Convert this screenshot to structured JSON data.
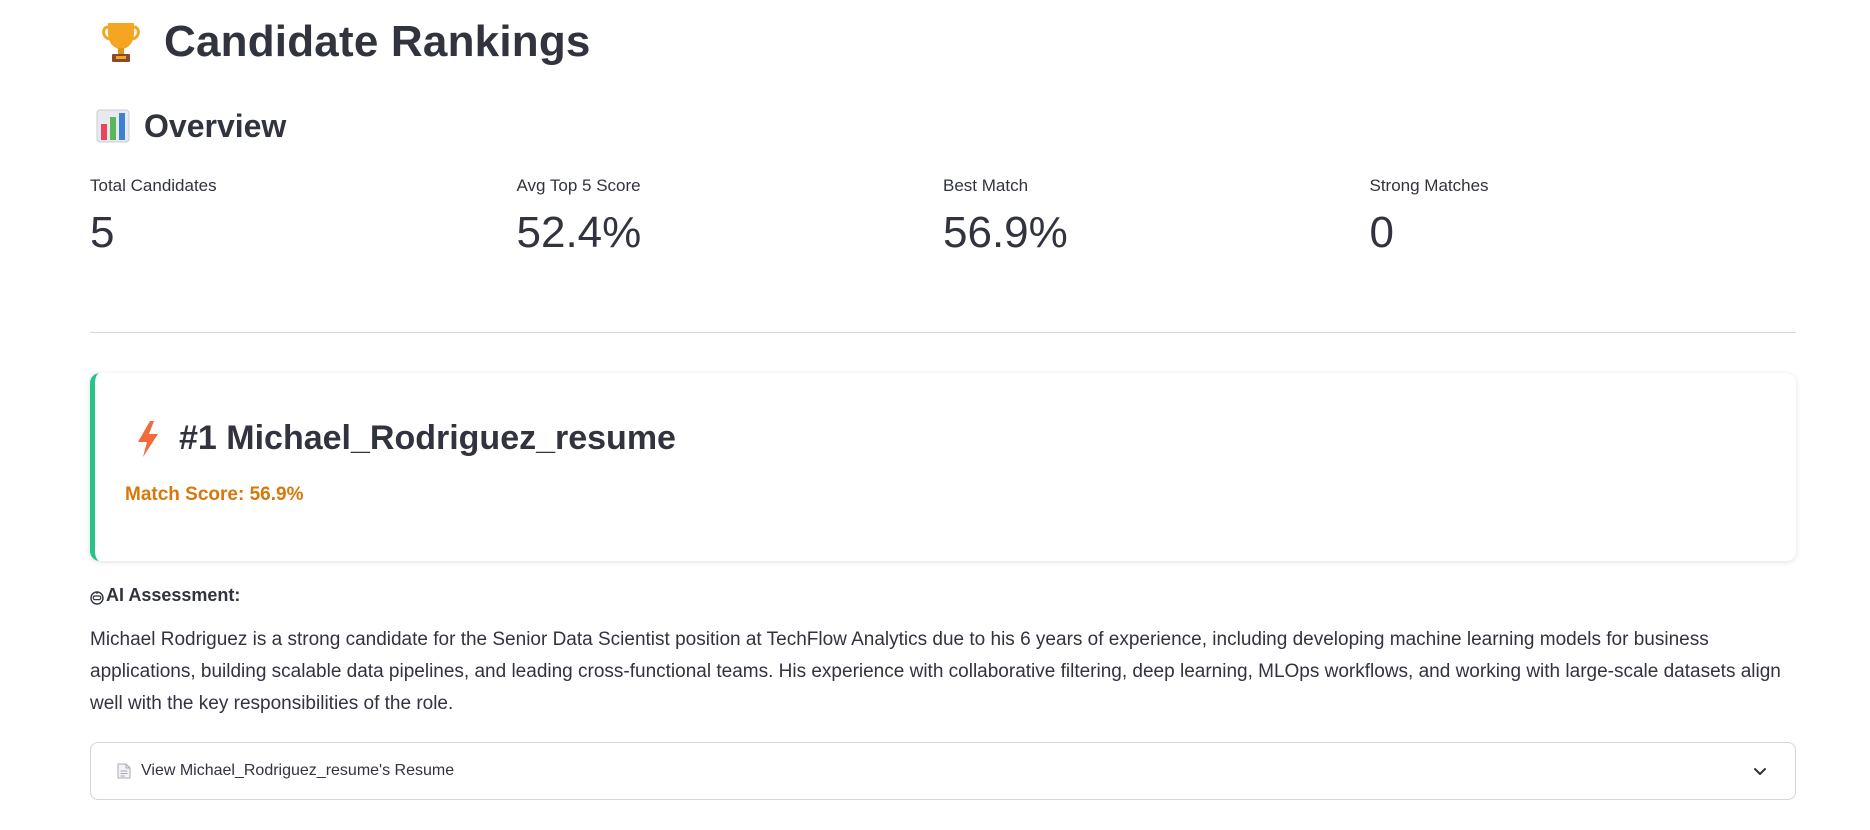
{
  "page": {
    "title": "Candidate Rankings",
    "title_icon": "trophy-icon"
  },
  "overview": {
    "title": "Overview",
    "icon": "bar-chart-icon",
    "metrics": [
      {
        "label": "Total Candidates",
        "value": "5"
      },
      {
        "label": "Avg Top 5 Score",
        "value": "52.4%"
      },
      {
        "label": "Best Match",
        "value": "56.9%"
      },
      {
        "label": "Strong Matches",
        "value": "0"
      }
    ]
  },
  "candidate": {
    "icon": "lightning-icon",
    "title": "#1 Michael_Rodriguez_resume",
    "match_score": "Match Score: 56.9%",
    "accent_color": "#27c38a",
    "score_color": "#d9770b"
  },
  "assessment": {
    "icon": "robot-icon",
    "heading": "AI Assessment:",
    "text": "Michael Rodriguez is a strong candidate for the Senior Data Scientist position at TechFlow Analytics due to his 6 years of experience, including developing machine learning models for business applications, building scalable data pipelines, and leading cross-functional teams. His experience with collaborative filtering, deep learning, MLOps workflows, and working with large-scale datasets align well with the key responsibilities of the role."
  },
  "expander": {
    "icon": "document-icon",
    "label": "View Michael_Rodriguez_resume's Resume",
    "chevron": "chevron-down-icon"
  }
}
